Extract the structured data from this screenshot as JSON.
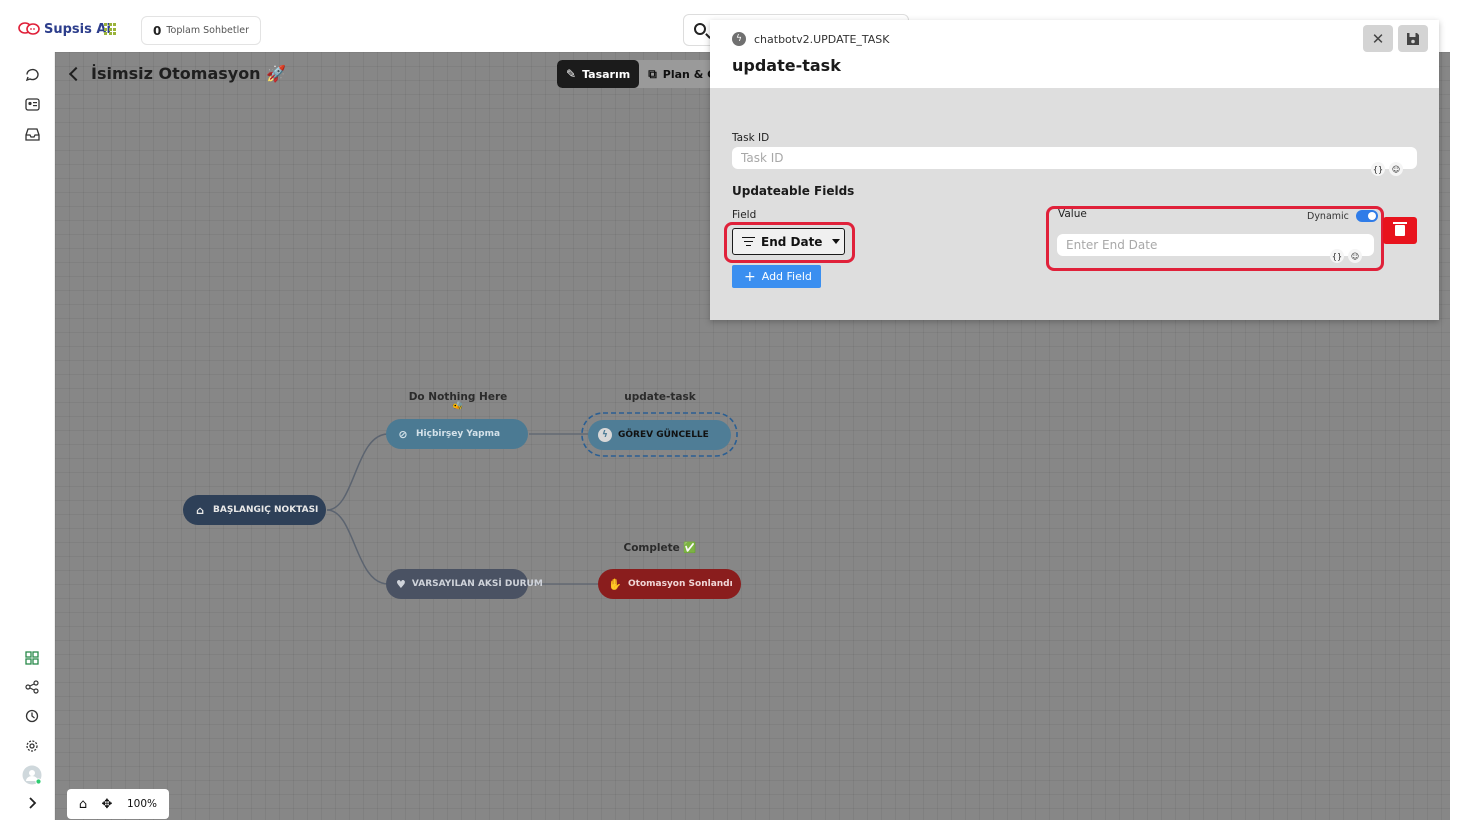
{
  "app": {
    "name": "Supsis Ai"
  },
  "header": {
    "chats_count": "0",
    "chats_label": "Toplam Sohbetler"
  },
  "page": {
    "title": "İsimsiz Otomasyon 🚀"
  },
  "mode_tabs": [
    {
      "label": "Tasarım",
      "active": true
    },
    {
      "label": "Plan & G",
      "active": false
    }
  ],
  "flow": {
    "nodes": {
      "start": {
        "text": "BAŞLANGIÇ NOKTASI",
        "color": "#2e4058"
      },
      "do_nothing": {
        "text": "Hiçbirşey Yapma",
        "label": "Do Nothing Here",
        "emoji": "🐝",
        "color": "#4b7a93"
      },
      "update_task": {
        "text": "GÖREV GÜNCELLE",
        "label": "update-task",
        "color": "#4f7d96"
      },
      "default": {
        "text": "VARSAYILAN AKSİ DURUM",
        "color": "#4a5263"
      },
      "end": {
        "text": "Otomasyon Sonlandı",
        "label": "Complete ✅",
        "color": "#8a1d1d"
      }
    }
  },
  "zoom": {
    "level": "100%"
  },
  "panel": {
    "type": "chatbotv2.UPDATE_TASK",
    "title": "update-task",
    "task_id": {
      "label": "Task ID",
      "placeholder": "Task ID",
      "value": ""
    },
    "updateable_fields_title": "Updateable Fields",
    "field_label": "Field",
    "field_value": "End Date",
    "value_label": "Value",
    "dynamic_label": "Dynamic",
    "dynamic_on": true,
    "value_placeholder": "Enter End Date",
    "add_field_label": "Add Field"
  },
  "colors": {
    "accent": "#3b8ff0",
    "danger": "#e8131d",
    "highlight": "#e0213a",
    "toggle": "#2f7ce8"
  }
}
